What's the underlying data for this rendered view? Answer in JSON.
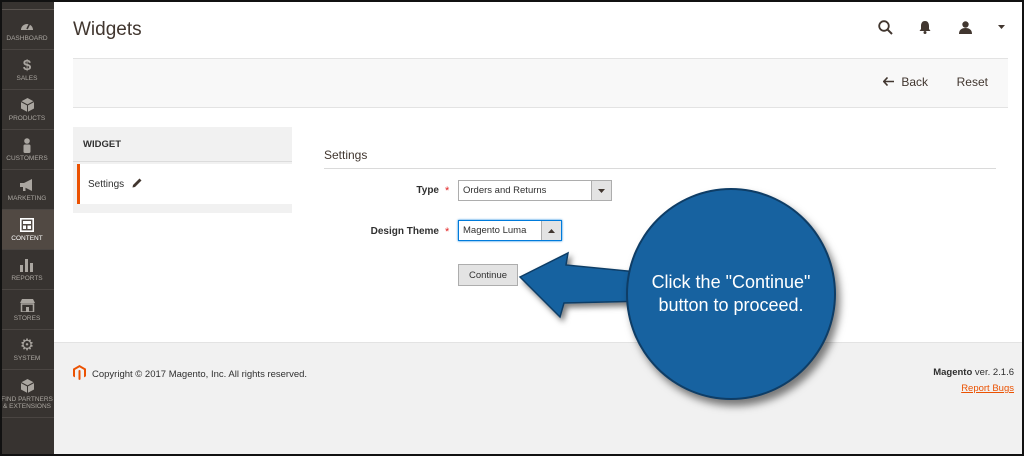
{
  "sidebar": {
    "items": [
      {
        "label": "Dashboard",
        "icon": "dashboard-icon"
      },
      {
        "label": "Sales",
        "icon": "dollar-icon"
      },
      {
        "label": "Products",
        "icon": "cube-icon"
      },
      {
        "label": "Customers",
        "icon": "person-icon"
      },
      {
        "label": "Marketing",
        "icon": "megaphone-icon"
      },
      {
        "label": "Content",
        "icon": "layout-icon"
      },
      {
        "label": "Reports",
        "icon": "bar-chart-icon"
      },
      {
        "label": "Stores",
        "icon": "store-icon"
      },
      {
        "label": "System",
        "icon": "gear-icon"
      },
      {
        "label": "Find Partners & Extensions",
        "icon": "box-icon"
      }
    ],
    "active_index": 5
  },
  "header": {
    "title": "Widgets",
    "icons": [
      "search-icon",
      "bell-icon",
      "user-icon",
      "caret-down-icon"
    ]
  },
  "actions": {
    "back_label": "Back",
    "reset_label": "Reset"
  },
  "tabs": {
    "title": "Widget",
    "items": [
      {
        "label": "Settings",
        "icon": "pencil-icon"
      }
    ]
  },
  "form": {
    "section_title": "Settings",
    "type_label": "Type",
    "type_value": "Orders and Returns",
    "theme_label": "Design Theme",
    "theme_value": "Magento Luma",
    "continue_label": "Continue"
  },
  "footer": {
    "copyright": "Copyright © 2017 Magento, Inc. All rights reserved.",
    "brand": "Magento",
    "version": " ver. 2.1.6",
    "report_bugs": "Report Bugs"
  },
  "callout": {
    "text": "Click the \"Continue\" button to proceed."
  },
  "colors": {
    "sidebar_bg": "#373330",
    "accent": "#eb5202",
    "callout_bg": "#1762a0"
  }
}
